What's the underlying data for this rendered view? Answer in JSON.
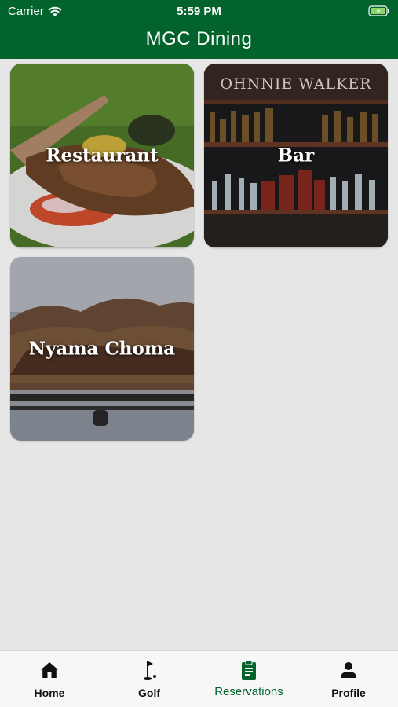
{
  "status_bar": {
    "carrier": "Carrier",
    "time": "5:59 PM"
  },
  "header": {
    "title": "MGC Dining"
  },
  "tiles": [
    {
      "label": "Restaurant"
    },
    {
      "label": "Bar",
      "sign_text": "OHNNIE WALKER"
    },
    {
      "label": "Nyama Choma"
    }
  ],
  "tabbar": {
    "tabs": [
      {
        "label": "Home",
        "icon": "home-icon"
      },
      {
        "label": "Golf",
        "icon": "golf-flag-icon"
      },
      {
        "label": "Reservations",
        "icon": "clipboard-icon",
        "active": true
      },
      {
        "label": "Profile",
        "icon": "person-icon"
      }
    ],
    "active_color": "#03632d"
  },
  "colors": {
    "header": "#03632d",
    "background": "#e6e6e6"
  }
}
